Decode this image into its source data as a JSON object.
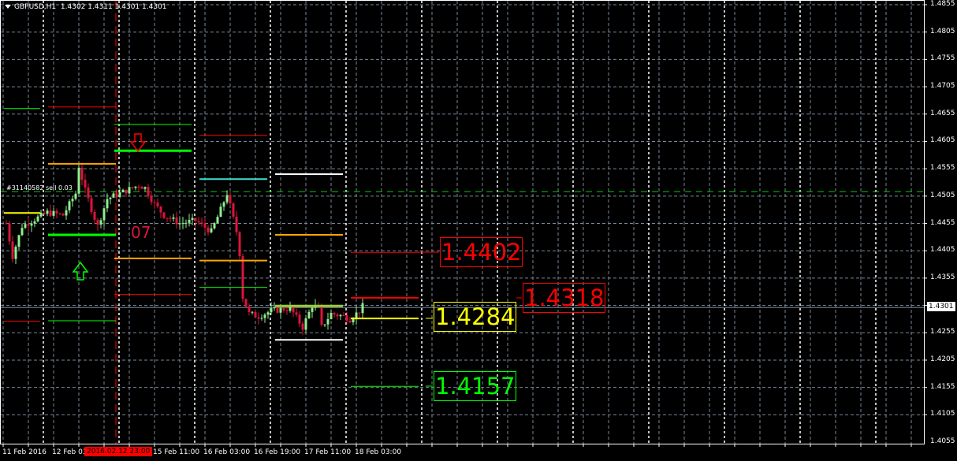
{
  "header": {
    "symbol": "GBPUSD,H1",
    "open": "1.4302",
    "high": "1.4311",
    "low": "1.4301",
    "close": "1.4301"
  },
  "price_axis": [
    "1.4855",
    "1.4805",
    "1.4755",
    "1.4705",
    "1.4655",
    "1.4605",
    "1.4555",
    "1.4505",
    "1.4455",
    "1.4405",
    "1.4355",
    "1.4255",
    "1.4205",
    "1.4155",
    "1.4105",
    "1.4055"
  ],
  "bid_label": "1.4301",
  "time_axis": [
    "11 Feb 2016",
    "12 Feb 03",
    "15 Feb 11:00",
    "16 Feb 03:00",
    "16 Feb 19:00",
    "17 Feb 11:00",
    "18 Feb 03:00"
  ],
  "cursor_time": "2016.02.12 23:00",
  "order_label": "#31140582 sell 0.03",
  "marker_text": "07",
  "price_boxes": [
    {
      "text": "1.4402",
      "color": "#ff0000"
    },
    {
      "text": "1.4318",
      "color": "#ff0000"
    },
    {
      "text": "1.4284",
      "color": "#ffff00"
    },
    {
      "text": "1.4157",
      "color": "#00ff00"
    }
  ],
  "colors": {
    "bull": "#90ee90",
    "bear": "#dc143c",
    "grid": "#778899",
    "background": "#000000"
  },
  "chart_data": {
    "type": "candlestick",
    "ylim": [
      1.4045,
      1.4865
    ],
    "price_path": [
      [
        0,
        1.4455
      ],
      [
        2,
        1.4395
      ],
      [
        5,
        1.445
      ],
      [
        13,
        1.4475
      ],
      [
        18,
        1.447
      ],
      [
        22,
        1.451
      ],
      [
        23,
        1.456
      ],
      [
        25,
        1.4515
      ],
      [
        28,
        1.4465
      ],
      [
        29,
        1.445
      ],
      [
        32,
        1.45
      ],
      [
        36,
        1.451
      ],
      [
        42,
        1.4525
      ],
      [
        44,
        1.452
      ],
      [
        47,
        1.449
      ],
      [
        50,
        1.447
      ],
      [
        55,
        1.4455
      ],
      [
        60,
        1.446
      ],
      [
        65,
        1.444
      ],
      [
        68,
        1.448
      ],
      [
        70,
        1.451
      ],
      [
        73,
        1.444
      ],
      [
        74,
        1.44
      ],
      [
        75,
        1.432
      ],
      [
        77,
        1.429
      ],
      [
        80,
        1.4285
      ],
      [
        84,
        1.4295
      ],
      [
        90,
        1.43
      ],
      [
        94,
        1.4265
      ],
      [
        97,
        1.4305
      ],
      [
        99,
        1.43
      ],
      [
        100,
        1.4265
      ],
      [
        103,
        1.429
      ],
      [
        107,
        1.4285
      ],
      [
        109,
        1.428
      ],
      [
        112,
        1.4295
      ],
      [
        113,
        1.4303
      ]
    ],
    "levels": [
      {
        "price": 1.4665,
        "from": 0,
        "to": 10,
        "color": "#00ff00",
        "width": 1
      },
      {
        "price": 1.4668,
        "from": 14,
        "to": 34,
        "color": "#ff0000",
        "width": 1
      },
      {
        "price": 1.4636,
        "from": 35,
        "to": 58,
        "color": "#00ff00",
        "width": 1
      },
      {
        "price": 1.4588,
        "from": 35,
        "to": 58,
        "color": "#00ff00",
        "width": 3
      },
      {
        "price": 1.4616,
        "from": 62,
        "to": 82,
        "color": "#ff0000",
        "width": 1
      },
      {
        "price": 1.4564,
        "from": 14,
        "to": 34,
        "color": "#ffa500",
        "width": 2
      },
      {
        "price": 1.4536,
        "from": 62,
        "to": 82,
        "color": "#40e0d0",
        "width": 2
      },
      {
        "price": 1.4545,
        "from": 86,
        "to": 106,
        "color": "#ffffff",
        "width": 2
      },
      {
        "price": 1.4474,
        "from": 0,
        "to": 10,
        "color": "#ffff00",
        "width": 2
      },
      {
        "price": 1.4434,
        "from": 14,
        "to": 34,
        "color": "#00ff00",
        "width": 3
      },
      {
        "price": 1.4434,
        "from": 86,
        "to": 106,
        "color": "#ffa500",
        "width": 2
      },
      {
        "price": 1.4391,
        "from": 35,
        "to": 58,
        "color": "#ffa500",
        "width": 2
      },
      {
        "price": 1.4387,
        "from": 62,
        "to": 82,
        "color": "#ffa500",
        "width": 2
      },
      {
        "price": 1.4402,
        "from": 110,
        "to": 130,
        "color": "#ff0000",
        "width": 1
      },
      {
        "price": 1.4338,
        "from": 62,
        "to": 82,
        "color": "#00ff00",
        "width": 1
      },
      {
        "price": 1.4325,
        "from": 35,
        "to": 58,
        "color": "#ff0000",
        "width": 1
      },
      {
        "price": 1.4319,
        "from": 110,
        "to": 130,
        "color": "#ff0000",
        "width": 2
      },
      {
        "price": 1.4304,
        "from": 86,
        "to": 106,
        "color": "#9acd32",
        "width": 3
      },
      {
        "price": 1.4281,
        "from": 110,
        "to": 130,
        "color": "#ffff00",
        "width": 2
      },
      {
        "price": 1.4277,
        "from": 14,
        "to": 34,
        "color": "#00ff00",
        "width": 1
      },
      {
        "price": 1.4276,
        "from": 0,
        "to": 10,
        "color": "#ff0000",
        "width": 1
      },
      {
        "price": 1.4242,
        "from": 86,
        "to": 106,
        "color": "#ffffff",
        "width": 2
      },
      {
        "price": 1.4157,
        "from": 110,
        "to": 130,
        "color": "#00ff00",
        "width": 1
      }
    ],
    "order_line": 1.4513,
    "bid": 1.4301
  }
}
